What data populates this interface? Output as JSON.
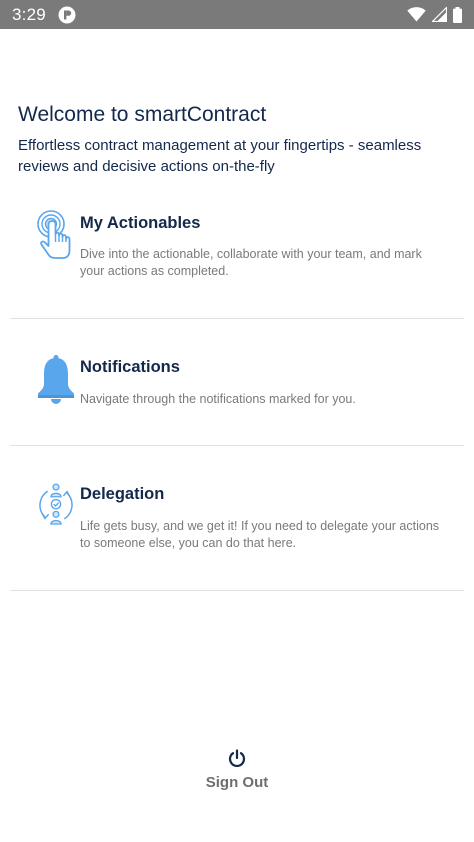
{
  "status_bar": {
    "time": "3:29"
  },
  "header": {
    "title": "Welcome to smartContract",
    "subtitle": "Effortless contract management at your fingertips - seamless reviews and decisive actions on-the-fly"
  },
  "sections": [
    {
      "title": "My Actionables",
      "description": "Dive into the actionable, collaborate with your team, and mark your actions as completed.",
      "icon": "tap-finger-icon"
    },
    {
      "title": "Notifications",
      "description": "Navigate through the notifications marked for you.",
      "icon": "bell-icon"
    },
    {
      "title": "Delegation",
      "description": "Life gets busy, and we get it! If you need to delegate your actions to someone else, you can do that here.",
      "icon": "delegation-icon"
    }
  ],
  "signout": {
    "label": "Sign Out",
    "icon": "power-icon"
  },
  "colors": {
    "status_bar": "#7a7a7a",
    "heading": "#14284b",
    "description": "#7a7a7a",
    "icon_blue": "#5aa6ec",
    "divider": "#e2e2e2"
  }
}
